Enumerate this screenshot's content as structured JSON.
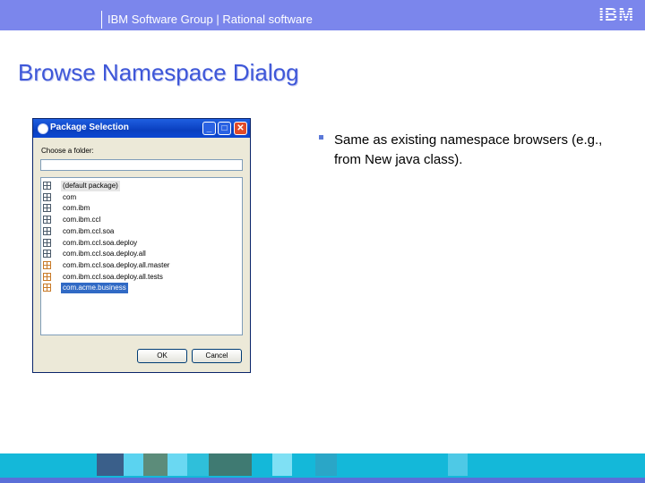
{
  "header": {
    "group_text": "IBM Software Group | Rational software",
    "logo_text": "IBM"
  },
  "slide": {
    "title": "Browse Namespace Dialog"
  },
  "dialog": {
    "title": "Package Selection",
    "minimize_glyph": "_",
    "maximize_glyph": "□",
    "close_glyph": "✕",
    "label": "Choose a folder:",
    "input_value": "",
    "items": [
      {
        "label": "(default package)",
        "icon": "package-icon"
      },
      {
        "label": "com",
        "icon": "package-icon"
      },
      {
        "label": "com.ibm",
        "icon": "package-icon"
      },
      {
        "label": "com.ibm.ccl",
        "icon": "package-icon"
      },
      {
        "label": "com.ibm.ccl.soa",
        "icon": "package-icon"
      },
      {
        "label": "com.ibm.ccl.soa.deploy",
        "icon": "package-icon"
      },
      {
        "label": "com.ibm.ccl.soa.deploy.all",
        "icon": "package-icon"
      },
      {
        "label": "com.ibm.ccl.soa.deploy.all.master",
        "icon": "package-icon"
      },
      {
        "label": "com.ibm.ccl.soa.deploy.all.tests",
        "icon": "package-icon"
      },
      {
        "label": "com.acme.business",
        "icon": "package-icon"
      }
    ],
    "selected_item": "com.acme.business",
    "ok_label": "OK",
    "cancel_label": "Cancel"
  },
  "bullets": [
    "Same as existing namespace browsers (e.g., from New java class)."
  ],
  "colors": {
    "header_band": "#7b86ec",
    "title": "#3e57d8",
    "footer": "#14b8d9",
    "selection": "#316ac5"
  }
}
